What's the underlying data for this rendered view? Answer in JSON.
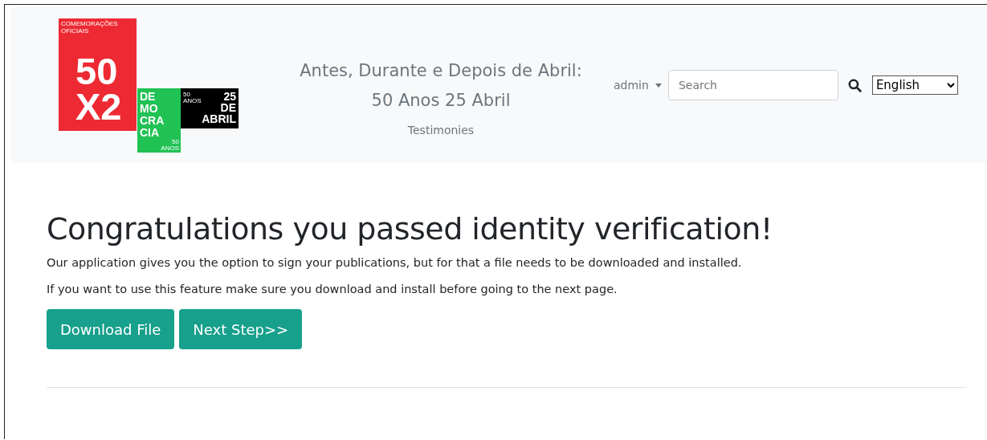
{
  "logo": {
    "red": {
      "caption": "COMEMORAÇÕES OFICIAIS",
      "line1": "50",
      "line2": "X2"
    },
    "green": {
      "lines": [
        "DE",
        "MO",
        "CRA",
        "CIA"
      ],
      "small": "50 ANOS"
    },
    "black": {
      "small": "50 ANOS",
      "lines": [
        "25",
        "DE",
        "ABRIL"
      ]
    }
  },
  "header": {
    "title_line1": "Antes, Durante e Depois de Abril:",
    "title_line2": "50 Anos 25 Abril",
    "subtitle": "Testimonies"
  },
  "user_menu": {
    "label": "admin"
  },
  "search": {
    "placeholder": "Search"
  },
  "language": {
    "value": "English"
  },
  "main": {
    "heading": "Congratulations you passed identity verification!",
    "paragraphs": [
      "Our application gives you the option to sign your publications, but for that a file needs to be downloaded and installed.",
      "If you want to use this feature make sure you download and install before going to the next page."
    ],
    "buttons": [
      "Download File",
      "Next Step>>"
    ]
  }
}
